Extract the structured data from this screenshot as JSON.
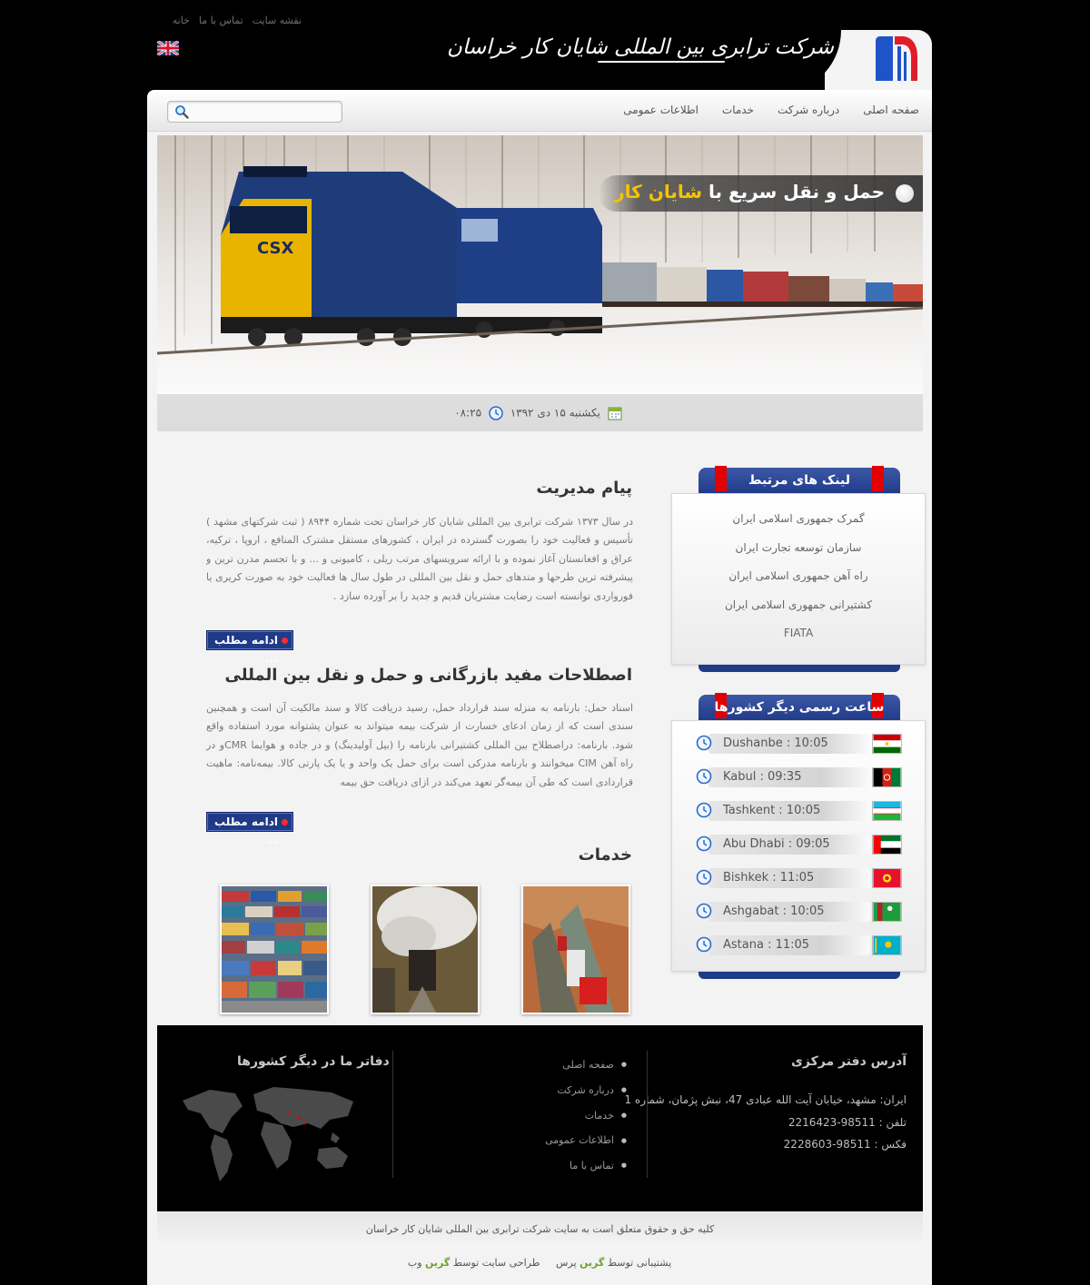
{
  "top_links": [
    "خانه",
    "تماس با ما",
    "نقشه سایت"
  ],
  "logo": {
    "text": "شرکت ترابری بین المللی شایان کار خراسان"
  },
  "nav": {
    "items": [
      "صفحه اصلی",
      "درباره شرکت",
      "خدمات",
      "اطلاعات عمومی"
    ],
    "search_placeholder": ""
  },
  "slider": {
    "caption_main": "حمل و نقل سریع با",
    "caption_accent": "شایان کار",
    "date": "یکشنبه ۱۵ دی ۱۳۹۲",
    "time": "۰۸:۲۵"
  },
  "articles": [
    {
      "title": "پیام مدیریت",
      "body": "در سال ۱۳۷۳ شرکت ترابری بین المللی شایان کار خراسان تحت شماره ۸۹۴۴ ( ثبت شرکتهای مشهد ) تأسیس و فعالیت خود را بصورت گسترده در ایران ، کشورهای مستقل مشترک المنافع ، اروپا ، ترکیه، عراق و افغانستان آغاز نموده و با ارائه سرویسهای مرتب ریلی ، کامیونی و ... و با تجسم مدرن ترین و پیشرفته ترین طرحها و متدهای حمل و نقل بین المللی در طول سال ها فعالیت خود به صورت کریری یا فورواردی توانسته است رضایت مشتریان قدیم و جدید را بر آورده سازد .",
      "more": "ادامه مطلب ..."
    },
    {
      "title": "اصطلاحات مفید بازرگانی و حمل و نقل بین المللی",
      "body": "اسناد حمل: بارنامه به منزله سند قرارداد حمل، رسید دریافت کالا و سند مالکیت آن است و همچنین سندی است که از زمان ادعای خسارت از شرکت بیمه میتواند به عنوان پشتوانه مورد استفاده واقع شود. بارنامه: دراصطلاح بین المللی کشتیرانی بارنامه را (بیل آولیدینگ) و در جاده و هوایما CMRو در راه آهن CIM میخوانند و بارنامه مدرکی است برای حمل یک واحد و یا یک پارتی کالا. بیمه‌نامه: ماهیت قراردادی است که طی آن بیمه‌گر تعهد می‌کند در ازای دریافت حق بیمه",
      "more": "ادامه مطلب ..."
    }
  ],
  "services": {
    "title": "خدمات",
    "images": [
      "trucks",
      "steam-train",
      "containers"
    ]
  },
  "sidebar": {
    "links_title": "لینک های مرتبط",
    "links": [
      "گمرک جمهوری اسلامی ایران",
      "سازمان توسعه تجارت ایران",
      "راه آهن جمهوری اسلامی ایران",
      "کشتیرانی جمهوری اسلامی ایران",
      "FIATA"
    ],
    "clocks_title": "ساعت رسمی دیگر کشورها",
    "clocks": [
      {
        "city": "Dushanbe : 10:05",
        "flag": "tajikistan"
      },
      {
        "city": "Kabul : 09:35",
        "flag": "afghanistan"
      },
      {
        "city": "Tashkent : 10:05",
        "flag": "uzbekistan"
      },
      {
        "city": "Abu Dhabi : 09:05",
        "flag": "uae"
      },
      {
        "city": "Bishkek : 11:05",
        "flag": "kyrgyzstan"
      },
      {
        "city": "Ashgabat : 10:05",
        "flag": "turkmenistan"
      },
      {
        "city": "Astana : 11:05",
        "flag": "kazakhstan"
      }
    ]
  },
  "footer": {
    "address_title": "آدرس دفتر مرکزی",
    "address": "ایران: مشهد، خیابان آیت الله عبادی 47، نبش پژمان، شماره 1",
    "phone": "تلفن : 98511-2216423",
    "fax": "فکس : 98511-2228603",
    "links": [
      "صفحه اصلی",
      "درباره شرکت",
      "خدمات",
      "اطلاعات عمومی",
      "تماس با ما"
    ],
    "offices_title": "دفاتر ما در دیگر کشورها",
    "copyright": "کلیه حق و حقوق متعلق است به سایت شرکت ترابری بین المللی شایان کار خراسان",
    "support_prefix": "پشتیبانی توسط",
    "support_brand": "گرین",
    "support_suffix": "پرس",
    "design_prefix": "طراحی سایت توسط",
    "design_brand": "گرین",
    "design_suffix": "وب"
  },
  "colors": {
    "nav_blue": "#1f3a87",
    "accent_red": "#e40000",
    "caption_yellow": "#f5c400",
    "brand_green": "#6ea02c"
  }
}
